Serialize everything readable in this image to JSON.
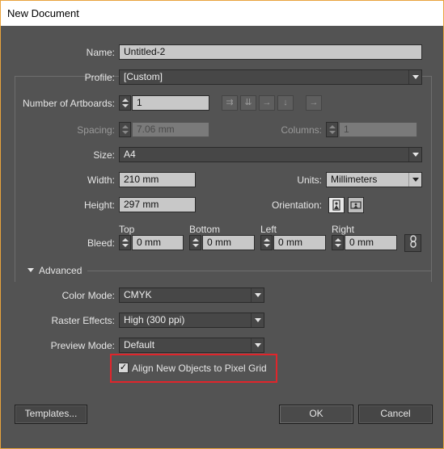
{
  "window": {
    "title": "New Document"
  },
  "name": {
    "label": "Name:",
    "value": "Untitled-2"
  },
  "profile": {
    "label": "Profile:",
    "value": "[Custom]"
  },
  "artboards": {
    "label": "Number of Artboards:",
    "value": "1"
  },
  "spacing": {
    "label": "Spacing:",
    "value": "7.06 mm"
  },
  "columns": {
    "label": "Columns:",
    "value": "1"
  },
  "size": {
    "label": "Size:",
    "value": "A4"
  },
  "width": {
    "label": "Width:",
    "value": "210 mm"
  },
  "units": {
    "label": "Units:",
    "value": "Millimeters"
  },
  "height": {
    "label": "Height:",
    "value": "297 mm"
  },
  "orientation": {
    "label": "Orientation:",
    "selected": "portrait"
  },
  "bleed": {
    "label": "Bleed:",
    "top": {
      "label": "Top",
      "value": "0 mm"
    },
    "bottom": {
      "label": "Bottom",
      "value": "0 mm"
    },
    "left": {
      "label": "Left",
      "value": "0 mm"
    },
    "right": {
      "label": "Right",
      "value": "0 mm"
    }
  },
  "advanced": {
    "label": "Advanced",
    "color_mode": {
      "label": "Color Mode:",
      "value": "CMYK"
    },
    "raster_effects": {
      "label": "Raster Effects:",
      "value": "High (300 ppi)"
    },
    "preview_mode": {
      "label": "Preview Mode:",
      "value": "Default"
    },
    "pixel_grid": {
      "label": "Align New Objects to Pixel Grid",
      "checked": true
    }
  },
  "buttons": {
    "templates": "Templates...",
    "ok": "OK",
    "cancel": "Cancel"
  },
  "colors": {
    "background": "#535353",
    "highlight": "#e0252b",
    "window_border": "#e8a33d"
  }
}
